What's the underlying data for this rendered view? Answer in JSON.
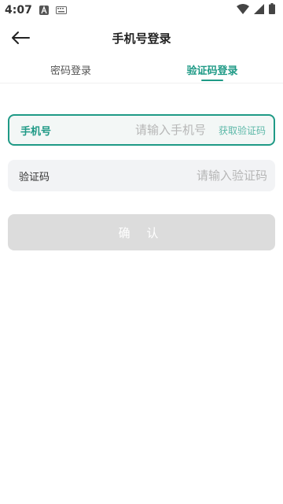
{
  "status_bar": {
    "time": "4:07"
  },
  "header": {
    "title": "手机号登录"
  },
  "tabs": [
    {
      "label": "密码登录",
      "active": false
    },
    {
      "label": "验证码登录",
      "active": true
    }
  ],
  "form": {
    "phone": {
      "label": "手机号",
      "placeholder": "请输入手机号",
      "get_code_label": "获取验证码"
    },
    "code": {
      "label": "验证码",
      "placeholder": "请输入验证码"
    },
    "confirm_label": "确 认"
  },
  "colors": {
    "accent": "#1f9a86",
    "get_code": "#5cb8a8",
    "button_disabled": "#dcdcdc"
  }
}
